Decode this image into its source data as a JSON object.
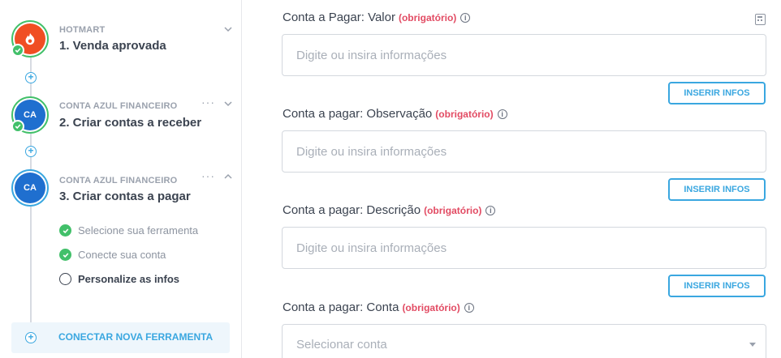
{
  "sidebar": {
    "steps": [
      {
        "app": "HOTMART",
        "title": "1. Venda aprovada",
        "icon": "hotmart-logo-icon"
      },
      {
        "app": "CONTA AZUL FINANCEIRO",
        "title": "2. Criar contas a receber",
        "badge": "CA"
      },
      {
        "app": "CONTA AZUL FINANCEIRO",
        "title": "3. Criar contas a pagar",
        "badge": "CA",
        "substeps": [
          "Selecione sua ferramenta",
          "Conecte sua conta",
          "Personalize as infos"
        ]
      }
    ],
    "dots": "···",
    "connect_label": "CONECTAR NOVA FERRAMENTA"
  },
  "form": {
    "required_label": "(obrigatório)",
    "info_glyph": "i",
    "placeholder": "Digite ou insira informações",
    "insert_button": "INSERIR INFOS",
    "fields": [
      {
        "label": "Conta a Pagar: Valor"
      },
      {
        "label": "Conta a pagar: Observação"
      },
      {
        "label": "Conta a pagar: Descrição"
      },
      {
        "label": "Conta a pagar: Conta"
      }
    ],
    "select_placeholder": "Selecionar conta"
  },
  "colors": {
    "accent": "#3aa7e0",
    "success": "#42c06a",
    "required": "#e24b63",
    "hotmart": "#f04e23",
    "contaazul": "#1f6fcf"
  }
}
